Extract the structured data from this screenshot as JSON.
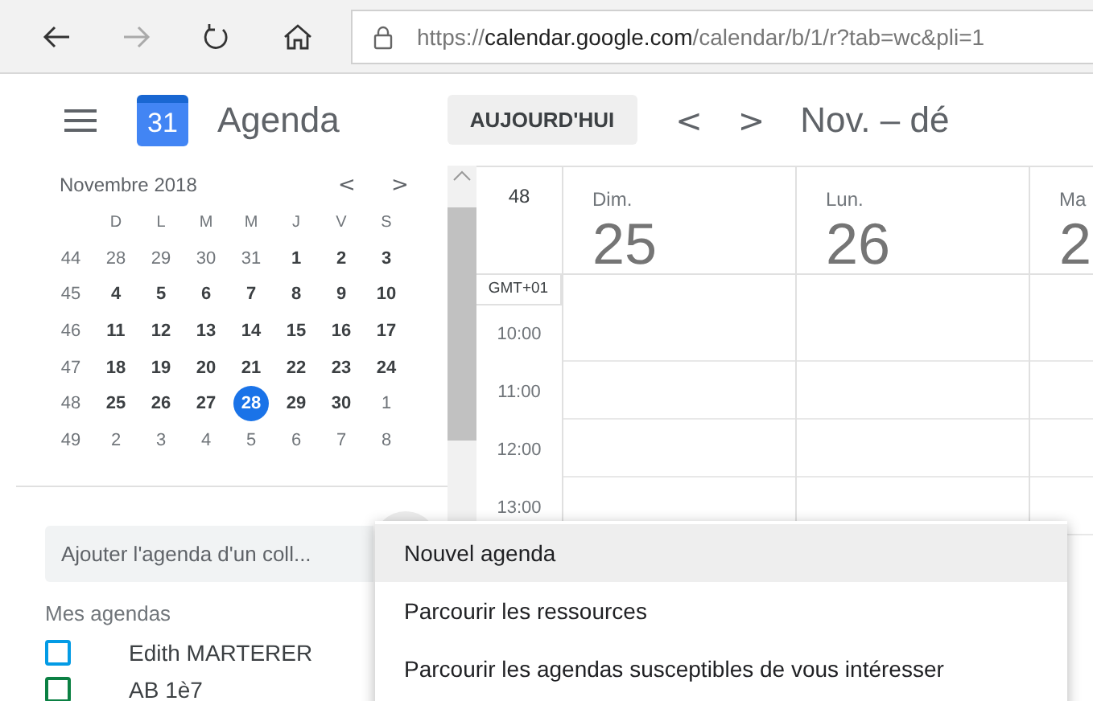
{
  "browser": {
    "url_host_prefix": "https://",
    "url_host": "calendar.google.com",
    "url_path": "/calendar/b/1/r?tab=wc&pli=1"
  },
  "header": {
    "logo_day": "31",
    "title": "Agenda",
    "today_button": "AUJOURD'HUI",
    "prev": "<",
    "next": ">",
    "range": "Nov. – dé"
  },
  "mini_calendar": {
    "title": "Novembre 2018",
    "prev": "<",
    "next": ">",
    "weekdays": [
      "D",
      "L",
      "M",
      "M",
      "J",
      "V",
      "S"
    ],
    "weeks": [
      {
        "number": "44",
        "days": [
          {
            "label": "28",
            "in_month": false,
            "selected": false
          },
          {
            "label": "29",
            "in_month": false,
            "selected": false
          },
          {
            "label": "30",
            "in_month": false,
            "selected": false
          },
          {
            "label": "31",
            "in_month": false,
            "selected": false
          },
          {
            "label": "1",
            "in_month": true,
            "selected": false
          },
          {
            "label": "2",
            "in_month": true,
            "selected": false
          },
          {
            "label": "3",
            "in_month": true,
            "selected": false
          }
        ]
      },
      {
        "number": "45",
        "days": [
          {
            "label": "4",
            "in_month": true,
            "selected": false
          },
          {
            "label": "5",
            "in_month": true,
            "selected": false
          },
          {
            "label": "6",
            "in_month": true,
            "selected": false
          },
          {
            "label": "7",
            "in_month": true,
            "selected": false
          },
          {
            "label": "8",
            "in_month": true,
            "selected": false
          },
          {
            "label": "9",
            "in_month": true,
            "selected": false
          },
          {
            "label": "10",
            "in_month": true,
            "selected": false
          }
        ]
      },
      {
        "number": "46",
        "days": [
          {
            "label": "11",
            "in_month": true,
            "selected": false
          },
          {
            "label": "12",
            "in_month": true,
            "selected": false
          },
          {
            "label": "13",
            "in_month": true,
            "selected": false
          },
          {
            "label": "14",
            "in_month": true,
            "selected": false
          },
          {
            "label": "15",
            "in_month": true,
            "selected": false
          },
          {
            "label": "16",
            "in_month": true,
            "selected": false
          },
          {
            "label": "17",
            "in_month": true,
            "selected": false
          }
        ]
      },
      {
        "number": "47",
        "days": [
          {
            "label": "18",
            "in_month": true,
            "selected": false
          },
          {
            "label": "19",
            "in_month": true,
            "selected": false
          },
          {
            "label": "20",
            "in_month": true,
            "selected": false
          },
          {
            "label": "21",
            "in_month": true,
            "selected": false
          },
          {
            "label": "22",
            "in_month": true,
            "selected": false
          },
          {
            "label": "23",
            "in_month": true,
            "selected": false
          },
          {
            "label": "24",
            "in_month": true,
            "selected": false
          }
        ]
      },
      {
        "number": "48",
        "days": [
          {
            "label": "25",
            "in_month": true,
            "selected": false
          },
          {
            "label": "26",
            "in_month": true,
            "selected": false
          },
          {
            "label": "27",
            "in_month": true,
            "selected": false
          },
          {
            "label": "28",
            "in_month": true,
            "selected": true
          },
          {
            "label": "29",
            "in_month": true,
            "selected": false
          },
          {
            "label": "30",
            "in_month": true,
            "selected": false
          },
          {
            "label": "1",
            "in_month": false,
            "selected": false
          }
        ]
      },
      {
        "number": "49",
        "days": [
          {
            "label": "2",
            "in_month": false,
            "selected": false
          },
          {
            "label": "3",
            "in_month": false,
            "selected": false
          },
          {
            "label": "4",
            "in_month": false,
            "selected": false
          },
          {
            "label": "5",
            "in_month": false,
            "selected": false
          },
          {
            "label": "6",
            "in_month": false,
            "selected": false
          },
          {
            "label": "7",
            "in_month": false,
            "selected": false
          },
          {
            "label": "8",
            "in_month": false,
            "selected": false
          }
        ]
      }
    ]
  },
  "add_calendar_field": {
    "placeholder": "Ajouter l'agenda d'un coll..."
  },
  "my_calendars": {
    "title": "Mes agendas",
    "items": [
      {
        "name": "Edith MARTERER",
        "checked": false,
        "color": "#039be5"
      },
      {
        "name": "AB 1è7",
        "checked": false,
        "color": "#0b8043"
      }
    ]
  },
  "week": {
    "week_number": "48",
    "timezone": "GMT+01",
    "days": [
      {
        "weekday": "Dim.",
        "date": "25"
      },
      {
        "weekday": "Lun.",
        "date": "26"
      },
      {
        "weekday": "Ma",
        "date": "2"
      }
    ],
    "hours": [
      "10:00",
      "11:00",
      "12:00",
      "13:00"
    ]
  },
  "menu": {
    "items": [
      {
        "label": "Nouvel agenda",
        "selected": true
      },
      {
        "label": "Parcourir les ressources",
        "selected": false
      },
      {
        "label": "Parcourir les agendas susceptibles de vous intéresser",
        "selected": false
      }
    ]
  }
}
